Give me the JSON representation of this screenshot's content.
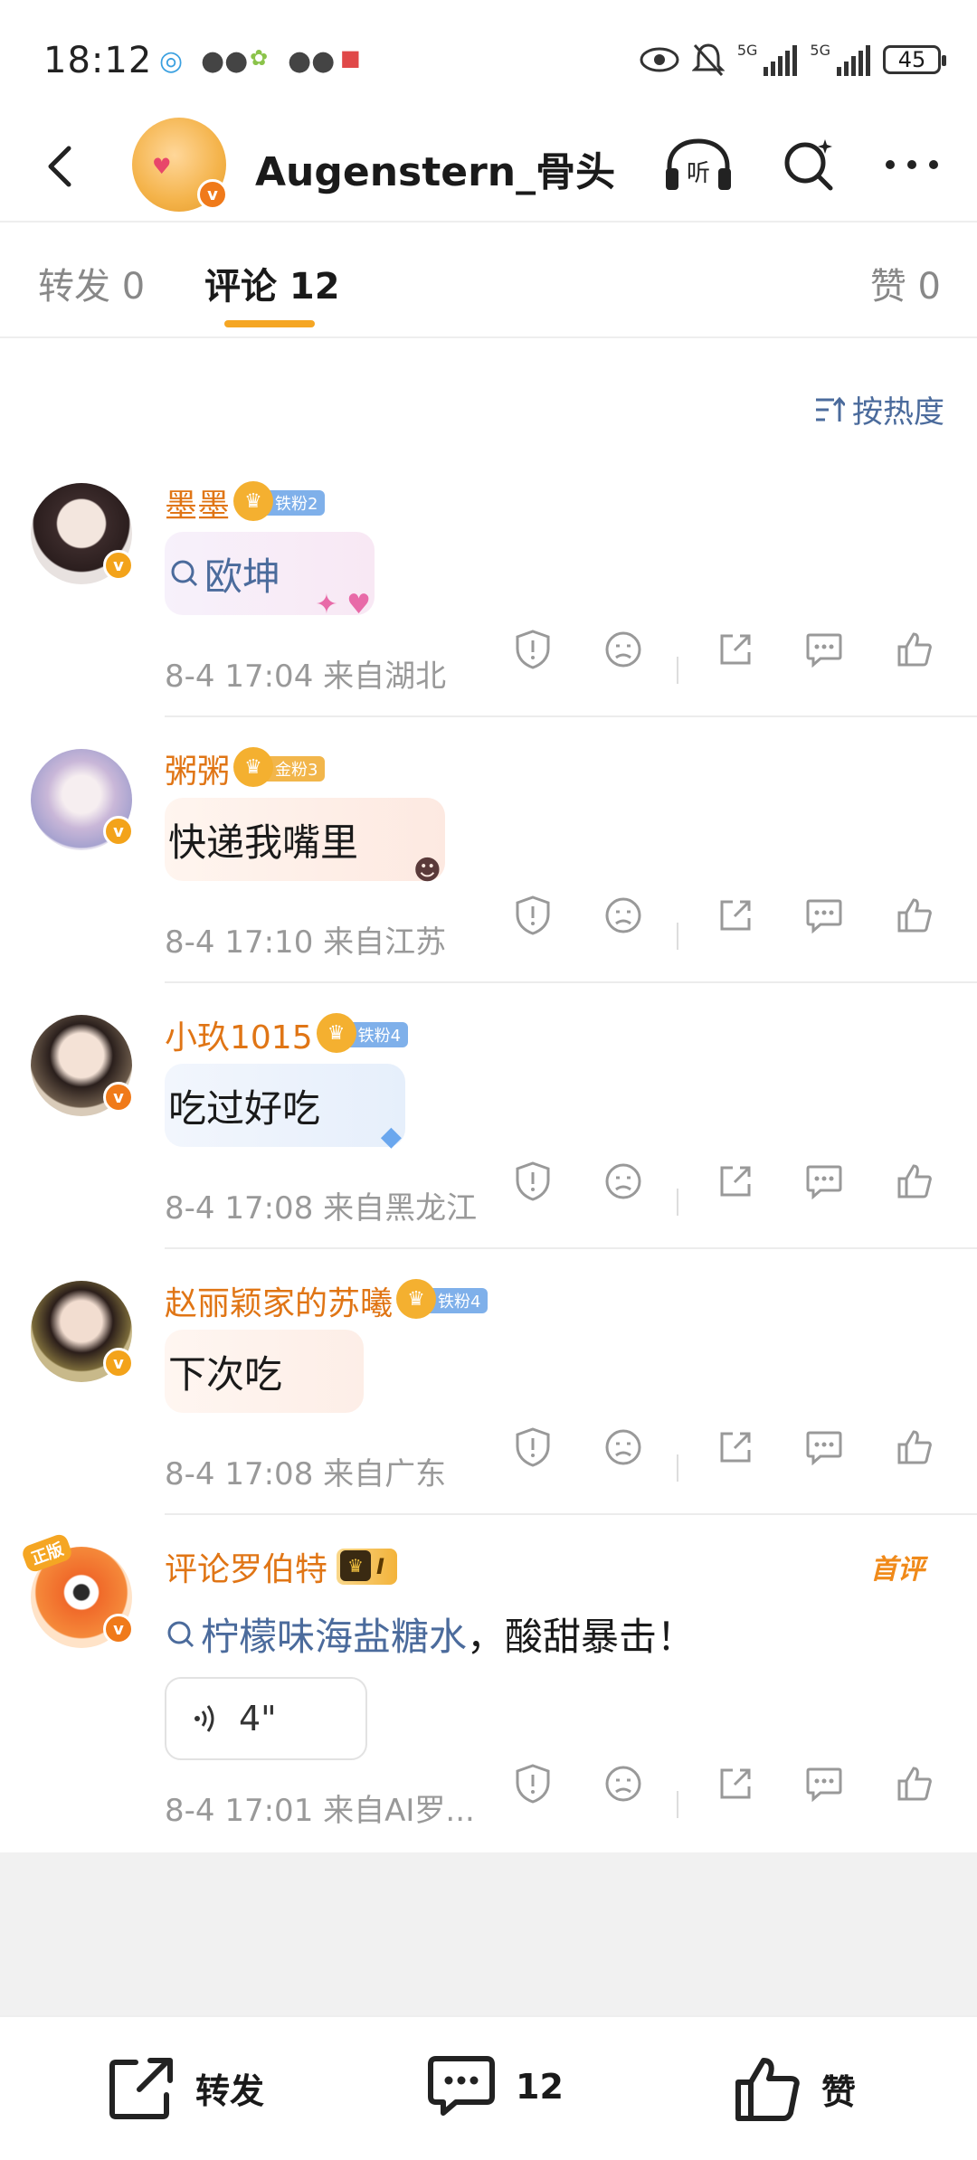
{
  "status_bar": {
    "time": "18:12",
    "battery": "45",
    "net1": "5G",
    "net2": "5G"
  },
  "header": {
    "title": "Augenstern_骨头"
  },
  "tabs": [
    {
      "label": "转发 0"
    },
    {
      "label": "评论 12"
    },
    {
      "label": "赞 0"
    }
  ],
  "sort_label": "按热度",
  "comments": [
    {
      "name": "墨墨",
      "fan_badge": "铁粉2",
      "search_prefix": "Q",
      "text": "欧坤",
      "time": "8-4 17:04",
      "location": "来自湖北"
    },
    {
      "name": "粥粥",
      "fan_badge": "金粉3",
      "text": "快递我嘴里",
      "time": "8-4 17:10",
      "location": "来自江苏"
    },
    {
      "name": "小玖1015",
      "fan_badge": "铁粉4",
      "text": "吃过好吃",
      "time": "8-4 17:08",
      "location": "来自黑龙江"
    },
    {
      "name": "赵丽颖家的苏曦",
      "fan_badge": "铁粉4",
      "text": "下次吃",
      "time": "8-4 17:08",
      "location": "来自广东"
    },
    {
      "name": "评论罗伯特",
      "rank_badge": "I",
      "first_tag": "首评",
      "link_text": "柠檬味海盐糖水",
      "text": "，酸甜暴击！",
      "voice_duration": "4\"",
      "time": "8-4 17:01",
      "location": "来自AI罗..."
    }
  ],
  "avatar_tag": "正版",
  "bottom_bar": {
    "repost": "转发",
    "comment_count": "12",
    "like": "赞"
  },
  "colors": {
    "accent": "#f5a623",
    "name": "#e07515",
    "link": "#4b6b9c"
  }
}
